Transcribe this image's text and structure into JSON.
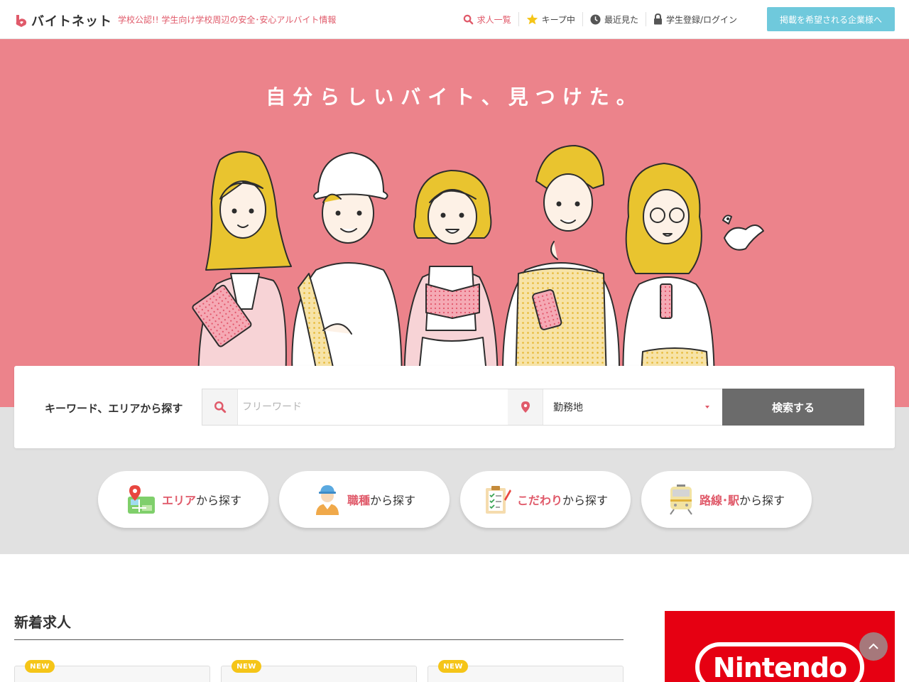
{
  "header": {
    "logo_text": "バイトネット",
    "tagline": "学校公認!! 学生向け学校周辺の安全･安心アルバイト情報",
    "nav": [
      {
        "label": "求人一覧",
        "icon": "search-icon"
      },
      {
        "label": "キープ中",
        "icon": "star-icon"
      },
      {
        "label": "最近見た",
        "icon": "clock-icon"
      },
      {
        "label": "学生登録/ログイン",
        "icon": "lock-icon"
      }
    ],
    "company_button": "掲載を希望される企業様へ"
  },
  "hero": {
    "title": "自分らしいバイト、見つけた。"
  },
  "search": {
    "label": "キーワード、エリアから探す",
    "keyword_placeholder": "フリーワード",
    "location_value": "勤務地",
    "button": "検索する"
  },
  "categories": [
    {
      "highlight": "エリア",
      "rest": "から探す",
      "icon": "map-pin-icon"
    },
    {
      "highlight": "職種",
      "rest": "から探す",
      "icon": "worker-icon"
    },
    {
      "highlight": "こだわり",
      "rest": "から探す",
      "icon": "checklist-icon"
    },
    {
      "highlight": "路線･駅",
      "rest": "から探す",
      "icon": "train-icon"
    }
  ],
  "new_jobs": {
    "title": "新着求人",
    "badge": "NEW"
  },
  "banner": {
    "brand": "Nintendo"
  },
  "colors": {
    "accent": "#e05a6a",
    "hero_bg": "#ec838b",
    "company_button": "#6fc9dc",
    "search_button": "#6b6b6b",
    "badge": "#f5c518",
    "banner": "#e60012"
  }
}
